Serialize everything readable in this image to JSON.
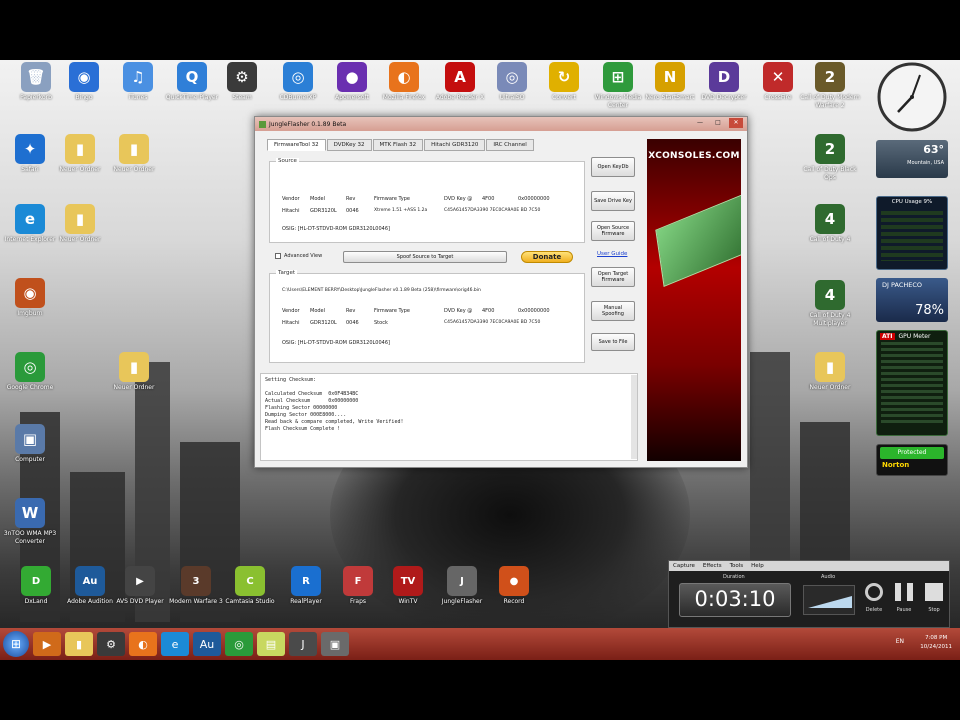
{
  "desktop_icons": [
    {
      "label": "Papierkorb",
      "icon": "recycle-bin-icon",
      "color": "#8aa0c0",
      "glyph": "🗑"
    },
    {
      "label": "Bingo",
      "icon": "globe-icon",
      "color": "#2a6fd6",
      "glyph": "◉"
    },
    {
      "label": "iTunes",
      "icon": "music-icon",
      "color": "#4a90e2",
      "glyph": "♫"
    },
    {
      "label": "QuickTime Player",
      "icon": "quicktime-icon",
      "color": "#2f7fd8",
      "glyph": "Q"
    },
    {
      "label": "Steam",
      "icon": "steam-icon",
      "color": "#3a3a3a",
      "glyph": "⚙"
    },
    {
      "label": "CDBurnerXP",
      "icon": "disc-icon",
      "color": "#2b7fd6",
      "glyph": "◎"
    },
    {
      "label": "Apowersoft",
      "icon": "ball-icon",
      "color": "#6a2fb0",
      "glyph": "●"
    },
    {
      "label": "Mozilla Firefox",
      "icon": "firefox-icon",
      "color": "#e8731c",
      "glyph": "◐"
    },
    {
      "label": "Adobe Reader X",
      "icon": "pdf-icon",
      "color": "#c40e0e",
      "glyph": "A"
    },
    {
      "label": "UltraISO",
      "icon": "disc-icon",
      "color": "#7a8ab8",
      "glyph": "◎"
    },
    {
      "label": "Convert",
      "icon": "convert-icon",
      "color": "#e0b000",
      "glyph": "↻"
    },
    {
      "label": "Windows Media Center",
      "icon": "windows-icon",
      "color": "#2f9a3c",
      "glyph": "⊞"
    },
    {
      "label": "Nero StartSmart",
      "icon": "nero-icon",
      "color": "#d6a000",
      "glyph": "N"
    },
    {
      "label": "DVD Decrypter",
      "icon": "dvd-icon",
      "color": "#5b3a9a",
      "glyph": "D"
    },
    {
      "label": "CrossFire",
      "icon": "crossfire-icon",
      "color": "#c02a2a",
      "glyph": "✕"
    },
    {
      "label": "Call of Duty Modern Warfare 2",
      "icon": "game-icon",
      "color": "#6a5a2a",
      "glyph": "2"
    },
    {
      "label": "Safari",
      "icon": "safari-icon",
      "color": "#1e6fd0",
      "glyph": "✦"
    },
    {
      "label": "Neuer Ordner",
      "icon": "folder-icon",
      "color": "#e8c65a",
      "glyph": "▮"
    },
    {
      "label": "Neuer Ordner",
      "icon": "folder-icon",
      "color": "#e8c65a",
      "glyph": "▮"
    },
    {
      "label": "Internet Explorer",
      "icon": "ie-icon",
      "color": "#1b8ad6",
      "glyph": "e"
    },
    {
      "label": "Neuer Ordner",
      "icon": "folder-icon",
      "color": "#e8c65a",
      "glyph": "▮"
    },
    {
      "label": "Imgburn",
      "icon": "burn-icon",
      "color": "#c0501c",
      "glyph": "◉"
    },
    {
      "label": "Google Chrome",
      "icon": "chrome-icon",
      "color": "#2a9a3a",
      "glyph": "◎"
    },
    {
      "label": "Neuer Ordner",
      "icon": "folder-icon",
      "color": "#e8c65a",
      "glyph": "▮"
    },
    {
      "label": "Computer",
      "icon": "computer-icon",
      "color": "#5a7aa8",
      "glyph": "▣"
    },
    {
      "label": "3nTOO WMA MP3 Converter",
      "icon": "converter-icon",
      "color": "#3a6ab0",
      "glyph": "W"
    },
    {
      "label": "Call of Duty Black Ops",
      "icon": "game-icon",
      "color": "#2f6a2f",
      "glyph": "2"
    },
    {
      "label": "Call of Duty 4",
      "icon": "game-icon",
      "color": "#2f6a2f",
      "glyph": "4"
    },
    {
      "label": "Call of Duty 4 Multiplayer",
      "icon": "game-icon",
      "color": "#2f6a2f",
      "glyph": "4"
    },
    {
      "label": "Neuer Ordner",
      "icon": "folder-icon",
      "color": "#e8c65a",
      "glyph": "▮"
    }
  ],
  "dock_icons": [
    {
      "label": "DxLand",
      "icon": "app-icon",
      "color": "#3a3",
      "glyph": "D"
    },
    {
      "label": "Adobe Audition",
      "icon": "audition-icon",
      "color": "#1e5a9a",
      "glyph": "Au"
    },
    {
      "label": "AVS DVD Player",
      "icon": "dvd-player-icon",
      "color": "#444",
      "glyph": "▶"
    },
    {
      "label": "Modern Warfare 3",
      "icon": "game-icon",
      "color": "#5a3a2a",
      "glyph": "3"
    },
    {
      "label": "Camtasia Studio",
      "icon": "camtasia-icon",
      "color": "#8ac030",
      "glyph": "C"
    },
    {
      "label": "RealPlayer",
      "icon": "realplayer-icon",
      "color": "#1a6fd0",
      "glyph": "R"
    },
    {
      "label": "Fraps",
      "icon": "fraps-icon",
      "color": "#c03a3a",
      "glyph": "F"
    },
    {
      "label": "WinTV",
      "icon": "tv-icon",
      "color": "#b01a1a",
      "glyph": "TV"
    },
    {
      "label": "JungleFlasher",
      "icon": "jungle-icon",
      "color": "#666",
      "glyph": "J"
    },
    {
      "label": "Record",
      "icon": "record-icon",
      "color": "#d0501a",
      "glyph": "●"
    }
  ],
  "window": {
    "title": "JungleFlasher 0.1.89 Beta",
    "controls": [
      "—",
      "□",
      "✕"
    ],
    "tabs": [
      "FirmwareTool 32",
      "DVDKey 32",
      "MTK Flash 32",
      "Hitachi GDR3120",
      "IRC Channel"
    ],
    "source": {
      "label": "Source",
      "headers": [
        "Vendor",
        "Model",
        "Rev",
        "Firmware Type",
        "DVD Key @",
        "4F00",
        "0x00000000"
      ],
      "row": [
        "Hitachi",
        "GDR3120L",
        "0046",
        "Xtreme 1.51 +ASS 1.2a",
        "C45A61457DA3390 7EC0CA9A0E BD 7C50"
      ],
      "osig": "OSIG: [HL-DT-STDVD-ROM GDR3120L0046]"
    },
    "advanced_view": "Advanced View",
    "spoof_button": "Spoof Source to Target",
    "donate": "Donate",
    "target": {
      "label": "Target",
      "path": "C:\\Users\\ELEMENT BERRY\\Desktop\\JungleFlasher v0.1.89 Beta (258)\\firmware\\orig46.bin",
      "headers": [
        "Vendor",
        "Model",
        "Rev",
        "Firmware Type",
        "DVD Key @",
        "4F00",
        "0x00000000"
      ],
      "row": [
        "Hitachi",
        "GDR3120L",
        "0046",
        "Stock",
        "C45A61457DA3390 7EC0CA9A0E BD 7C50"
      ],
      "osig": "OSIG: [HL-DT-STDVD-ROM GDR3120L0046]"
    },
    "side_buttons": {
      "open_keydb": "Open KeyDb",
      "save_drive_key": "Save Drive Key",
      "open_source_fw": "Open Source Firmware",
      "user_guide": "User Guide",
      "open_target_fw": "Open Target Firmware",
      "manual_spoofing": "Manual Spoofing",
      "save_to_file": "Save to File"
    },
    "log_lines": [
      "Setting Checksum:",
      "",
      "Calculated Checksum  0x0F4B34BC",
      "Actual Checksum      0x00000000",
      "Flashing Sector 00000000",
      "Dumping Sector 000E8000....",
      "Read back & compare completed, Write Verified!",
      "Flash Checksum Complete !"
    ],
    "banner_logo": "XCONSOLES.COM",
    "banner_color": "#b30000"
  },
  "gadgets": {
    "weather_temp": "63°",
    "weather_location": "Mountain, USA",
    "cpu_title": "CPU Usage  9%",
    "user_name": "DJ PACHECO",
    "user_percent": "78%",
    "gpu_title": "GPU Meter",
    "norton_status": "Protected",
    "norton_brand": "Norton"
  },
  "recorder": {
    "menu": [
      "Capture",
      "Effects",
      "Tools",
      "Help"
    ],
    "duration_label": "Duration",
    "duration": "0:03:10",
    "audio_label": "Audio",
    "buttons": [
      "Delete",
      "Pause",
      "Stop"
    ]
  },
  "taskbar": {
    "lang": "EN",
    "time": "7:08 PM",
    "date": "10/24/2011",
    "items": [
      {
        "icon": "media-player-icon",
        "glyph": "▶",
        "color": "#d06a1a"
      },
      {
        "icon": "folder-icon",
        "glyph": "▮",
        "color": "#e8c65a"
      },
      {
        "icon": "steam-icon",
        "glyph": "⚙",
        "color": "#3a3a3a"
      },
      {
        "icon": "firefox-icon",
        "glyph": "◐",
        "color": "#e8731c"
      },
      {
        "icon": "ie-icon",
        "glyph": "e",
        "color": "#1b8ad6"
      },
      {
        "icon": "audition-icon",
        "glyph": "Au",
        "color": "#1e5a9a"
      },
      {
        "icon": "chrome-icon",
        "glyph": "◎",
        "color": "#2a9a3a"
      },
      {
        "icon": "notes-icon",
        "glyph": "▤",
        "color": "#c8d860"
      },
      {
        "icon": "jungle-icon",
        "glyph": "J",
        "color": "#4a4a4a"
      },
      {
        "icon": "app-icon",
        "glyph": "▣",
        "color": "#6a6a6a"
      }
    ]
  }
}
